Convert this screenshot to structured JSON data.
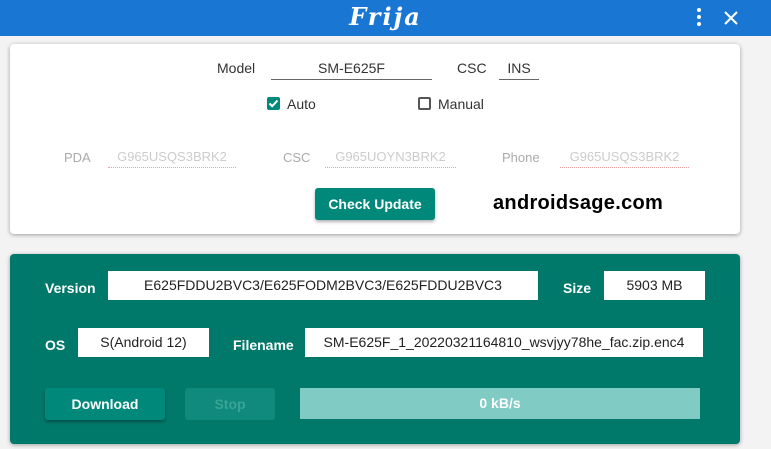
{
  "titlebar": {
    "title": "Frija",
    "color": "#1976d2",
    "menu_icon": "more-vertical-icon",
    "close_icon": "close-icon"
  },
  "query": {
    "model_label": "Model",
    "model_value": "SM-E625F",
    "csc_label": "CSC",
    "csc_value": "INS",
    "auto_label": "Auto",
    "auto_checked": true,
    "manual_label": "Manual",
    "manual_checked": false,
    "pda_label": "PDA",
    "pda_placeholder": "G965USQS3BRK2",
    "csc2_label": "CSC",
    "csc2_placeholder": "G965UOYN3BRK2",
    "phone_label": "Phone",
    "phone_placeholder": "G965USQS3BRK2",
    "check_update_label": "Check Update"
  },
  "watermark": "androidsage.com",
  "result": {
    "version_label": "Version",
    "version_value": "E625FDDU2BVC3/E625FODM2BVC3/E625FDDU2BVC3",
    "size_label": "Size",
    "size_value": "5903 MB",
    "os_label": "OS",
    "os_value": "S(Android 12)",
    "filename_label": "Filename",
    "filename_value": "SM-E625F_1_20220321164810_wsvjyy78he_fac.zip.enc4",
    "download_label": "Download",
    "stop_label": "Stop",
    "speed_value": "0 kB/s",
    "progress_fraction": 0
  },
  "colors": {
    "accent": "#00897b",
    "panel": "#00796b",
    "progress": "#80cbc4"
  }
}
